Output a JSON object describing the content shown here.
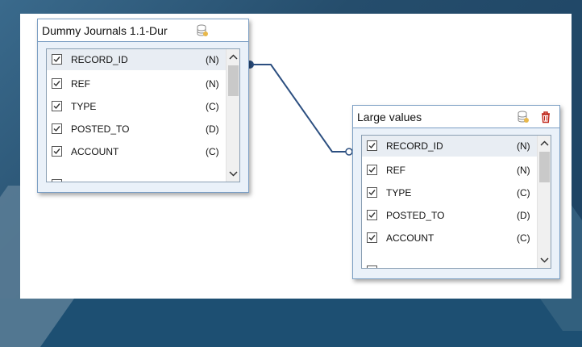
{
  "tables": [
    {
      "title": "Dummy Journals 1.1-Dur",
      "fields": [
        {
          "name": "RECORD_ID",
          "type": "(N)",
          "checked": true
        },
        {
          "name": "REF",
          "type": "(N)",
          "checked": true
        },
        {
          "name": "TYPE",
          "type": "(C)",
          "checked": true
        },
        {
          "name": "POSTED_TO",
          "type": "(D)",
          "checked": true
        },
        {
          "name": "ACCOUNT",
          "type": "(C)",
          "checked": true
        }
      ]
    },
    {
      "title": "Large values",
      "fields": [
        {
          "name": "RECORD_ID",
          "type": "(N)",
          "checked": true
        },
        {
          "name": "REF",
          "type": "(N)",
          "checked": true
        },
        {
          "name": "TYPE",
          "type": "(C)",
          "checked": true
        },
        {
          "name": "POSTED_TO",
          "type": "(D)",
          "checked": true
        },
        {
          "name": "ACCOUNT",
          "type": "(C)",
          "checked": true
        }
      ]
    }
  ],
  "colors": {
    "connector": "#2c4f80",
    "table_border": "#7c9fc4",
    "delete_icon": "#c0281c",
    "db_icon": "#e8b84a"
  },
  "icons": {
    "table1_header": "database-icon",
    "table2_header": [
      "database-icon",
      "trash-icon"
    ]
  }
}
